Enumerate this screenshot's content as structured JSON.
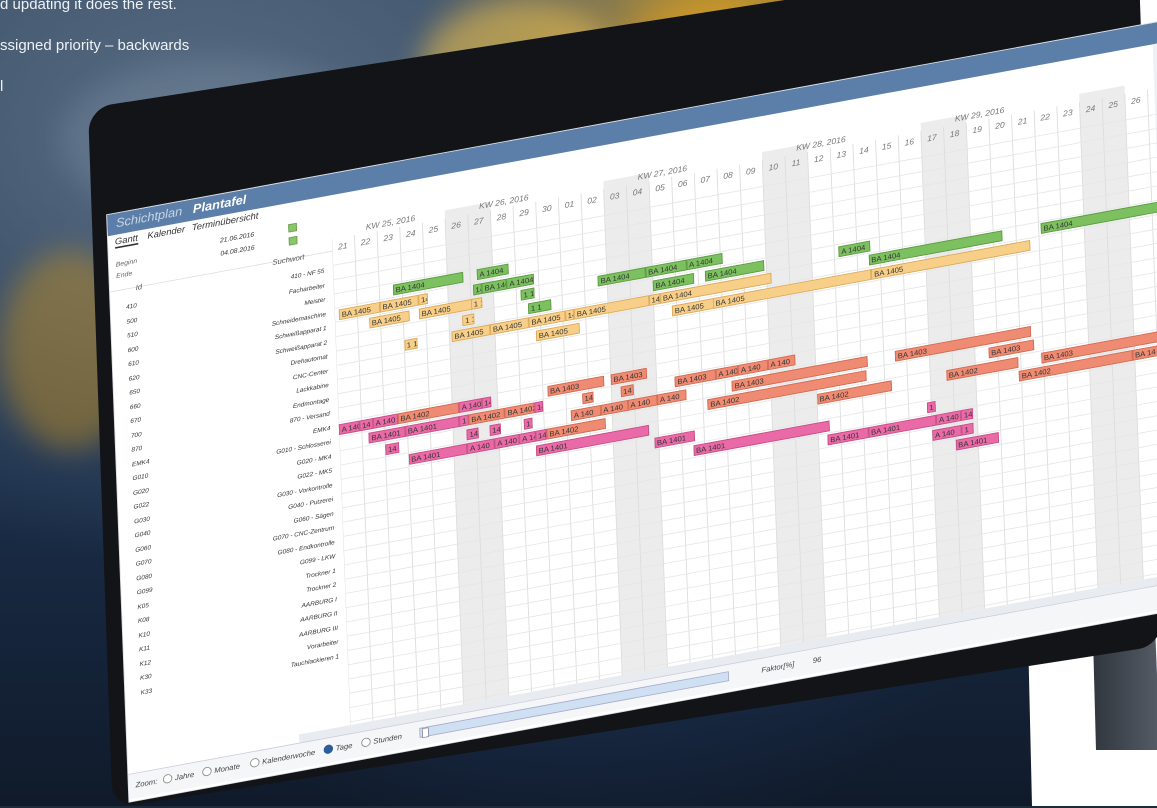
{
  "overlay_text": [
    "d updating it does the rest.",
    "ssigned priority – backwards",
    "l"
  ],
  "window": {
    "tabs": [
      "Schichtplan",
      "Plantafel"
    ],
    "subtabs": [
      "Gantt",
      "Kalender",
      "Terminübersicht"
    ],
    "begin_label": "Beginn",
    "end_label": "Ende",
    "begin_date": "21.06.2016",
    "end_date": "04.08.2016"
  },
  "columns": {
    "id": "Id",
    "suchwort": "Suchwort"
  },
  "resources": [
    {
      "id": "410",
      "name": "410 - NF 55"
    },
    {
      "id": "500",
      "name": "Facharbeiter"
    },
    {
      "id": "510",
      "name": "Meister"
    },
    {
      "id": "600",
      "name": "Schneidemaschine"
    },
    {
      "id": "610",
      "name": "Schweißapparat 1"
    },
    {
      "id": "620",
      "name": "Schweißapparat 2"
    },
    {
      "id": "650",
      "name": "Drehautomat"
    },
    {
      "id": "660",
      "name": "CNC-Center"
    },
    {
      "id": "670",
      "name": "Lackkabine"
    },
    {
      "id": "700",
      "name": "Endmontage"
    },
    {
      "id": "870",
      "name": "870 - Versand"
    },
    {
      "id": "EMK4",
      "name": "EMK4"
    },
    {
      "id": "G010",
      "name": "G010 - Schlosserei"
    },
    {
      "id": "G020",
      "name": "G020 - MK4"
    },
    {
      "id": "G022",
      "name": "G022 - MK5"
    },
    {
      "id": "G030",
      "name": "G030 - Vorkontrolle"
    },
    {
      "id": "G040",
      "name": "G040 - Putzerei"
    },
    {
      "id": "G060",
      "name": "G060 - Sägen"
    },
    {
      "id": "G070",
      "name": "G070 - CNC-Zentrum"
    },
    {
      "id": "G080",
      "name": "G080 - Endkontrolle"
    },
    {
      "id": "G099",
      "name": "G099 - LKW"
    },
    {
      "id": "K05",
      "name": "Trockner 1"
    },
    {
      "id": "K08",
      "name": "Trockner 2"
    },
    {
      "id": "K10",
      "name": "AARBURG I"
    },
    {
      "id": "K11",
      "name": "AARBURG II"
    },
    {
      "id": "K12",
      "name": "AARBURG III"
    },
    {
      "id": "K30",
      "name": "Vorarbeiter"
    },
    {
      "id": "K33",
      "name": "Tauchlackieren 1"
    }
  ],
  "weeks": [
    "KW 25, 2016",
    "KW 26, 2016",
    "KW 27, 2016",
    "KW 28, 2016",
    "KW 29, 2016"
  ],
  "days": [
    "21",
    "22",
    "23",
    "24",
    "25",
    "26",
    "27",
    "28",
    "29",
    "30",
    "01",
    "02",
    "03",
    "04",
    "05",
    "06",
    "07",
    "08",
    "09",
    "10",
    "11",
    "12",
    "13",
    "14",
    "15",
    "16",
    "17",
    "18",
    "19",
    "20",
    "21",
    "22",
    "23",
    "24",
    "25",
    "26"
  ],
  "bars": [
    {
      "row": 2,
      "start": 2.6,
      "len": 3.1,
      "label": "BA 1404",
      "c": "g"
    },
    {
      "row": 2,
      "start": 6.3,
      "len": 1.4,
      "label": "A 1404",
      "c": "g"
    },
    {
      "row": 3,
      "start": 0.2,
      "len": 1.8,
      "label": "BA 1405",
      "c": "o"
    },
    {
      "row": 3,
      "start": 2.0,
      "len": 1.7,
      "label": "BA 1405",
      "c": "o"
    },
    {
      "row": 3,
      "start": 3.7,
      "len": 0.4,
      "label": "14",
      "c": "o"
    },
    {
      "row": 3,
      "start": 6.1,
      "len": 0.4,
      "label": "14",
      "c": "g"
    },
    {
      "row": 3,
      "start": 6.5,
      "len": 1.1,
      "label": "BA 1404",
      "c": "g"
    },
    {
      "row": 3,
      "start": 7.6,
      "len": 1.2,
      "label": "A 1404",
      "c": "g"
    },
    {
      "row": 4,
      "start": 1.5,
      "len": 1.8,
      "label": "BA 1405",
      "c": "o"
    },
    {
      "row": 4,
      "start": 3.7,
      "len": 2.6,
      "label": "BA 1405",
      "c": "o"
    },
    {
      "row": 4,
      "start": 6.0,
      "len": 0.5,
      "label": "1 1",
      "c": "o"
    },
    {
      "row": 4,
      "start": 8.2,
      "len": 0.6,
      "label": "1 1",
      "c": "g"
    },
    {
      "row": 4,
      "start": 11.6,
      "len": 2.1,
      "label": "BA 1404",
      "c": "g"
    },
    {
      "row": 4,
      "start": 13.7,
      "len": 1.8,
      "label": "BA 1404",
      "c": "g"
    },
    {
      "row": 4,
      "start": 15.5,
      "len": 1.6,
      "label": "A 1404",
      "c": "g"
    },
    {
      "row": 5,
      "start": 5.6,
      "len": 0.5,
      "label": "1 1",
      "c": "o"
    },
    {
      "row": 5,
      "start": 8.5,
      "len": 1.0,
      "label": "1 1",
      "c": "g"
    },
    {
      "row": 5,
      "start": 14.0,
      "len": 1.8,
      "label": "BA 1404",
      "c": "g"
    },
    {
      "row": 5,
      "start": 16.3,
      "len": 2.6,
      "label": "BA 1404",
      "c": "g"
    },
    {
      "row": 5,
      "start": 22.2,
      "len": 1.4,
      "label": "A 1404",
      "c": "g"
    },
    {
      "row": 6,
      "start": 3.0,
      "len": 0.6,
      "label": "1 1",
      "c": "o"
    },
    {
      "row": 6,
      "start": 5.1,
      "len": 1.7,
      "label": "BA 1405",
      "c": "o"
    },
    {
      "row": 6,
      "start": 6.8,
      "len": 1.7,
      "label": "BA 1405",
      "c": "o"
    },
    {
      "row": 6,
      "start": 8.5,
      "len": 1.6,
      "label": "BA 1405",
      "c": "o"
    },
    {
      "row": 6,
      "start": 10.1,
      "len": 0.4,
      "label": "14",
      "c": "o"
    },
    {
      "row": 6,
      "start": 10.5,
      "len": 3.3,
      "label": "BA 1405",
      "c": "o"
    },
    {
      "row": 6,
      "start": 13.8,
      "len": 0.5,
      "label": "14",
      "c": "o"
    },
    {
      "row": 6,
      "start": 14.3,
      "len": 4.9,
      "label": "BA 1404",
      "c": "o"
    },
    {
      "row": 6,
      "start": 23.5,
      "len": 5.9,
      "label": "BA 1404",
      "c": "g"
    },
    {
      "row": 6,
      "start": 31.1,
      "len": 7.0,
      "label": "BA 1404",
      "c": "g"
    },
    {
      "row": 7,
      "start": 8.8,
      "len": 1.9,
      "label": "BA 1405",
      "c": "o"
    },
    {
      "row": 7,
      "start": 14.8,
      "len": 1.9,
      "label": "BA 1405",
      "c": "o"
    },
    {
      "row": 7,
      "start": 16.6,
      "len": 7.0,
      "label": "BA 1405",
      "c": "o"
    },
    {
      "row": 7,
      "start": 23.6,
      "len": 7.0,
      "label": "BA 1405",
      "c": "o"
    },
    {
      "row": 11,
      "start": -0.3,
      "len": 1.2,
      "label": "A 140",
      "c": "p"
    },
    {
      "row": 11,
      "start": 0.9,
      "len": 0.6,
      "label": "14",
      "c": "p"
    },
    {
      "row": 11,
      "start": 1.5,
      "len": 1.1,
      "label": "A 140",
      "c": "p"
    },
    {
      "row": 11,
      "start": 2.6,
      "len": 2.7,
      "label": "BA 1402",
      "c": "r"
    },
    {
      "row": 11,
      "start": 5.3,
      "len": 1.0,
      "label": "A 140",
      "c": "p"
    },
    {
      "row": 11,
      "start": 6.3,
      "len": 0.4,
      "label": "14",
      "c": "p"
    },
    {
      "row": 11,
      "start": 9.2,
      "len": 2.5,
      "label": "BA 1403",
      "c": "r"
    },
    {
      "row": 11,
      "start": 12.0,
      "len": 1.6,
      "label": "BA 1403",
      "c": "r"
    },
    {
      "row": 12,
      "start": 1.3,
      "len": 1.6,
      "label": "BA 1401",
      "c": "p"
    },
    {
      "row": 12,
      "start": 2.9,
      "len": 2.4,
      "label": "BA 1401",
      "c": "p"
    },
    {
      "row": 12,
      "start": 5.3,
      "len": 0.4,
      "label": "1",
      "c": "p"
    },
    {
      "row": 12,
      "start": 5.7,
      "len": 1.6,
      "label": "BA 1402",
      "c": "r"
    },
    {
      "row": 12,
      "start": 7.3,
      "len": 1.3,
      "label": "BA 1402",
      "c": "r"
    },
    {
      "row": 12,
      "start": 8.6,
      "len": 0.4,
      "label": "14",
      "c": "p"
    },
    {
      "row": 12,
      "start": 10.7,
      "len": 0.5,
      "label": "14",
      "c": "r"
    },
    {
      "row": 12,
      "start": 12.4,
      "len": 0.6,
      "label": "14",
      "c": "r"
    },
    {
      "row": 12,
      "start": 14.8,
      "len": 1.8,
      "label": "BA 1403",
      "c": "r"
    },
    {
      "row": 12,
      "start": 16.6,
      "len": 1.0,
      "label": "A 140",
      "c": "r"
    },
    {
      "row": 12,
      "start": 17.6,
      "len": 1.3,
      "label": "A 140",
      "c": "r"
    },
    {
      "row": 12,
      "start": 18.9,
      "len": 1.2,
      "label": "A 140",
      "c": "r"
    },
    {
      "row": 13,
      "start": 2.0,
      "len": 0.6,
      "label": "14",
      "c": "p"
    },
    {
      "row": 13,
      "start": 5.6,
      "len": 0.5,
      "label": "14",
      "c": "p"
    },
    {
      "row": 13,
      "start": 6.6,
      "len": 0.5,
      "label": "14",
      "c": "p"
    },
    {
      "row": 13,
      "start": 8.1,
      "len": 0.4,
      "label": "1",
      "c": "p"
    },
    {
      "row": 13,
      "start": 10.2,
      "len": 1.3,
      "label": "A 140",
      "c": "r"
    },
    {
      "row": 13,
      "start": 11.5,
      "len": 1.2,
      "label": "A 140",
      "c": "r"
    },
    {
      "row": 13,
      "start": 12.7,
      "len": 1.3,
      "label": "A 140",
      "c": "r"
    },
    {
      "row": 13,
      "start": 14.0,
      "len": 1.3,
      "label": "A 140",
      "c": "r"
    },
    {
      "row": 13,
      "start": 17.3,
      "len": 6.0,
      "label": "BA 1403",
      "c": "r"
    },
    {
      "row": 13,
      "start": 24.5,
      "len": 6.0,
      "label": "BA 1403",
      "c": "r"
    },
    {
      "row": 14,
      "start": 3.0,
      "len": 2.6,
      "label": "BA 1401",
      "c": "p"
    },
    {
      "row": 14,
      "start": 5.6,
      "len": 1.2,
      "label": "A 140",
      "c": "p"
    },
    {
      "row": 14,
      "start": 6.8,
      "len": 1.1,
      "label": "A 140",
      "c": "p"
    },
    {
      "row": 14,
      "start": 7.9,
      "len": 0.7,
      "label": "A 14",
      "c": "p"
    },
    {
      "row": 14,
      "start": 8.6,
      "len": 0.5,
      "label": "14",
      "c": "p"
    },
    {
      "row": 14,
      "start": 9.1,
      "len": 2.6,
      "label": "BA 1402",
      "c": "r"
    },
    {
      "row": 14,
      "start": 16.2,
      "len": 7.0,
      "label": "BA 1402",
      "c": "r"
    },
    {
      "row": 14,
      "start": 28.6,
      "len": 2.0,
      "label": "BA 1403",
      "c": "r"
    },
    {
      "row": 15,
      "start": 8.6,
      "len": 5.0,
      "label": "BA 1401",
      "c": "p"
    },
    {
      "row": 15,
      "start": 21.0,
      "len": 3.3,
      "label": "BA 1402",
      "c": "r"
    },
    {
      "row": 15,
      "start": 26.7,
      "len": 3.2,
      "label": "BA 1402",
      "c": "r"
    },
    {
      "row": 15,
      "start": 30.9,
      "len": 6.0,
      "label": "BA 1403",
      "c": "r"
    },
    {
      "row": 16,
      "start": 13.8,
      "len": 1.8,
      "label": "BA 1401",
      "c": "p"
    },
    {
      "row": 16,
      "start": 29.9,
      "len": 5.0,
      "label": "BA 1402",
      "c": "r"
    },
    {
      "row": 16,
      "start": 34.9,
      "len": 2.0,
      "label": "BA 14",
      "c": "r"
    },
    {
      "row": 17,
      "start": 15.5,
      "len": 6.0,
      "label": "BA 1401",
      "c": "p"
    },
    {
      "row": 17,
      "start": 25.8,
      "len": 0.4,
      "label": "1",
      "c": "p"
    },
    {
      "row": 18,
      "start": 21.4,
      "len": 1.8,
      "label": "BA 1401",
      "c": "p"
    },
    {
      "row": 18,
      "start": 23.2,
      "len": 3.0,
      "label": "BA 1401",
      "c": "p"
    },
    {
      "row": 18,
      "start": 26.2,
      "len": 1.1,
      "label": "A 140",
      "c": "p"
    },
    {
      "row": 18,
      "start": 27.3,
      "len": 0.5,
      "label": "14",
      "c": "p"
    },
    {
      "row": 19,
      "start": 26.0,
      "len": 1.3,
      "label": "A 140",
      "c": "p"
    },
    {
      "row": 19,
      "start": 27.3,
      "len": 0.5,
      "label": "1",
      "c": "p"
    },
    {
      "row": 20,
      "start": 27.0,
      "len": 1.9,
      "label": "BA 1401",
      "c": "p"
    }
  ],
  "bottombar": {
    "zoom_label": "Zoom:",
    "options": [
      "Jahre",
      "Monate",
      "Kalenderwoche",
      "Tage",
      "Stunden"
    ],
    "selected": "Tage",
    "factor_label": "Faktor[%]",
    "factor_value": "96"
  },
  "colors": {
    "orange": "#f8cf88",
    "green": "#7cc060",
    "salmon": "#ef8b72",
    "pink": "#e96aa6",
    "titlebar": "#5b7fa8"
  }
}
